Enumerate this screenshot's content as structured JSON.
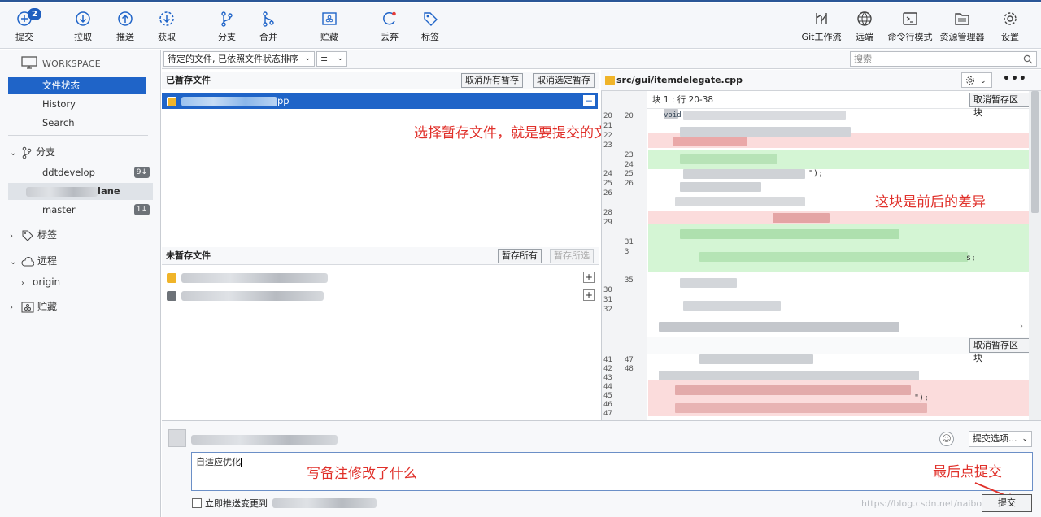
{
  "toolbar": {
    "commit": {
      "label": "提交",
      "badge": "2"
    },
    "pull": "拉取",
    "push": "推送",
    "fetch": "获取",
    "branch": "分支",
    "merge": "合并",
    "stash": "贮藏",
    "discard": "丢弃",
    "tag": "标签",
    "gitflow": "Git工作流",
    "remote": "远端",
    "terminal": "命令行模式",
    "explorer": "资源管理器",
    "settings": "设置"
  },
  "sidebar": {
    "workspace": "WORKSPACE",
    "items": [
      "文件状态",
      "History",
      "Search"
    ],
    "branches_label": "分支",
    "branches": [
      {
        "name": "ddtdevelop",
        "count": "9↓"
      },
      {
        "name": "lane",
        "count": ""
      },
      {
        "name": "master",
        "count": "1↓"
      }
    ],
    "tags_label": "标签",
    "remotes_label": "远程",
    "remotes": [
      "origin"
    ],
    "stash_label": "贮藏"
  },
  "filter": {
    "sort": "待定的文件, 已依照文件状态排序",
    "view": "≡",
    "search_placeholder": "搜索"
  },
  "staged": {
    "title": "已暂存文件",
    "unstage_all": "取消所有暂存",
    "unstage_selected": "取消选定暂存",
    "file_suffix": "pp"
  },
  "unstaged": {
    "title": "未暂存文件",
    "stage_all": "暂存所有",
    "stage_selected": "暂存所选"
  },
  "diff": {
    "file": "src/gui/itemdelegate.cpp",
    "hunk1": "块 1 : 行 20-38",
    "unstage_hunk": "取消暂存区块",
    "line_numbers_1": [
      [
        "20",
        "20"
      ],
      [
        "21",
        ""
      ],
      [
        "22",
        ""
      ],
      [
        "23",
        ""
      ],
      [
        "",
        "23"
      ],
      [
        "",
        "24"
      ],
      [
        "24",
        "25"
      ],
      [
        "25",
        "26"
      ],
      [
        "26",
        ""
      ],
      [
        "",
        ""
      ],
      [
        "28",
        ""
      ],
      [
        "29",
        ""
      ],
      [
        "",
        ""
      ],
      [
        "",
        "31"
      ],
      [
        "",
        "3"
      ],
      [
        "",
        ""
      ],
      [
        "",
        ""
      ],
      [
        "",
        "35"
      ],
      [
        "30",
        ""
      ],
      [
        "31",
        ""
      ],
      [
        "32",
        ""
      ]
    ],
    "line_numbers_2": [
      [
        "41",
        "47"
      ],
      [
        "42",
        "48"
      ],
      [
        "43",
        ""
      ],
      [
        "44",
        ""
      ],
      [
        "45",
        ""
      ],
      [
        "46",
        ""
      ],
      [
        "47",
        ""
      ]
    ],
    "code_fragment_1": "void",
    "code_fragment_2": "\");",
    "code_fragment_3": "s;",
    "code_fragment_4": "\");"
  },
  "commit": {
    "message": "自适应优化",
    "push_option": "立即推送变更到",
    "options": "提交选项...",
    "submit": "提交",
    "watermark": "https://blog.csdn.net/naibozhuan"
  },
  "annotations": {
    "staged_note": "选择暂存文件，就是要提交的文件",
    "diff_note": "这块是前后的差异",
    "message_note": "写备注修改了什么",
    "submit_note": "最后点提交"
  },
  "colors": {
    "accent": "#1f64c8",
    "annotation": "#e0302a",
    "added": "#d4f5d4",
    "removed": "#fbdcdc"
  }
}
